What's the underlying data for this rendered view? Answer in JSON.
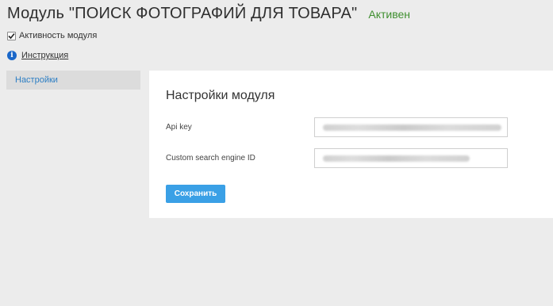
{
  "header": {
    "title": "Модуль \"ПОИСК ФОТОГРАФИЙ ДЛЯ ТОВАРА\"",
    "status": "Активен",
    "status_color": "#3f8f2f"
  },
  "activity": {
    "label": "Активность модуля",
    "checked": true
  },
  "instruction": {
    "icon": "info-icon",
    "label": "Инструкция"
  },
  "sidebar": {
    "items": [
      {
        "label": "Настройки",
        "active": true
      }
    ]
  },
  "main": {
    "title": "Настройки модуля",
    "fields": [
      {
        "label": "Api key",
        "value_obscured": true
      },
      {
        "label": "Custom search engine ID",
        "value_obscured": true
      }
    ],
    "save_label": "Сохранить"
  },
  "colors": {
    "accent": "#3aa0e6",
    "link": "#2c7ec4",
    "background": "#ececec"
  }
}
